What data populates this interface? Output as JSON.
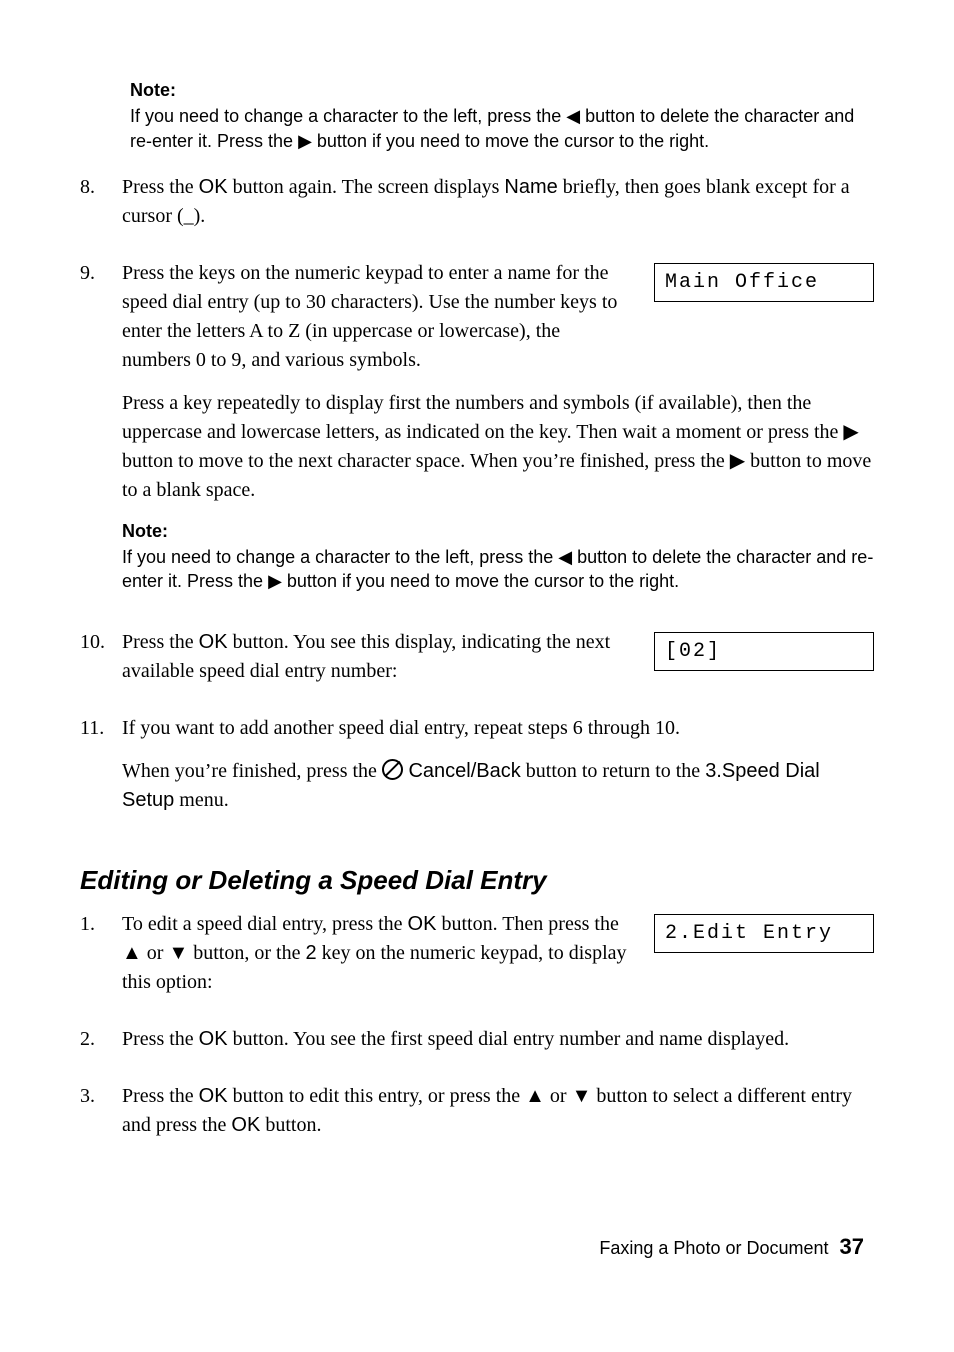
{
  "notes": {
    "title": "Note:",
    "note1": "If you need to change a character to the left, press the ◀ button to delete the character and re-enter it. Press the ▶ button if you need to move the cursor to the right.",
    "note2": "If you need to change a character to the left, press the ◀ button to delete the character and re-enter it. Press the ▶ button if you need to move the cursor to the right."
  },
  "steps": {
    "s8": {
      "num": "8.",
      "p1a": "Press the ",
      "ok": "OK",
      "p1b": " button again. The screen displays ",
      "name": "Name",
      "p1c": " briefly, then goes blank except for a cursor (_)."
    },
    "s9": {
      "num": "9.",
      "p1": "Press the keys on the numeric keypad to enter a name for the speed dial entry (up to 30 characters). Use the number keys to enter the letters A to Z (in uppercase or lowercase), the numbers 0 to 9, and various symbols.",
      "p2": "Press a key repeatedly to display first the numbers and symbols (if available), then the uppercase and lowercase letters, as indicated on the key. Then wait a moment or press the ▶ button to move to the next character space. When you’re finished, press the ▶ button to move to a blank space."
    },
    "s10": {
      "num": "10.",
      "p1a": "Press the ",
      "ok": "OK",
      "p1b": " button. You see this display, indicating the next available speed dial entry number:"
    },
    "s11": {
      "num": "11.",
      "p1": "If you want to add another speed dial entry, repeat steps 6 through 10.",
      "p2a": "When you’re finished, press the ",
      "cancel": " Cancel/Back",
      "p2b": " button to return to the ",
      "menu": "3.Speed Dial Setup",
      "p2c": " menu."
    }
  },
  "section_heading": "Editing or Deleting a Speed Dial Entry",
  "edit": {
    "s1": {
      "num": "1.",
      "p1a": "To edit a speed dial entry, press the ",
      "ok": "OK",
      "p1b": " button. Then press the ▲ or ▼ button, or the ",
      "two": "2",
      "p1c": " key on the numeric keypad, to display this option:"
    },
    "s2": {
      "num": "2.",
      "p1a": "Press the ",
      "ok": "OK",
      "p1b": " button. You see the first speed dial entry number and name displayed."
    },
    "s3": {
      "num": "3.",
      "p1a": "Press the ",
      "ok": "OK",
      "p1b": " button to edit this entry, or press the ▲ or ▼ button to select a different entry and press the ",
      "ok2": "OK",
      "p1c": " button."
    }
  },
  "lcd": {
    "main_office": "Main Office",
    "next_entry": "[02]",
    "edit_entry": "2.Edit Entry"
  },
  "footer": {
    "label": "Faxing a Photo or Document",
    "page": "37"
  }
}
